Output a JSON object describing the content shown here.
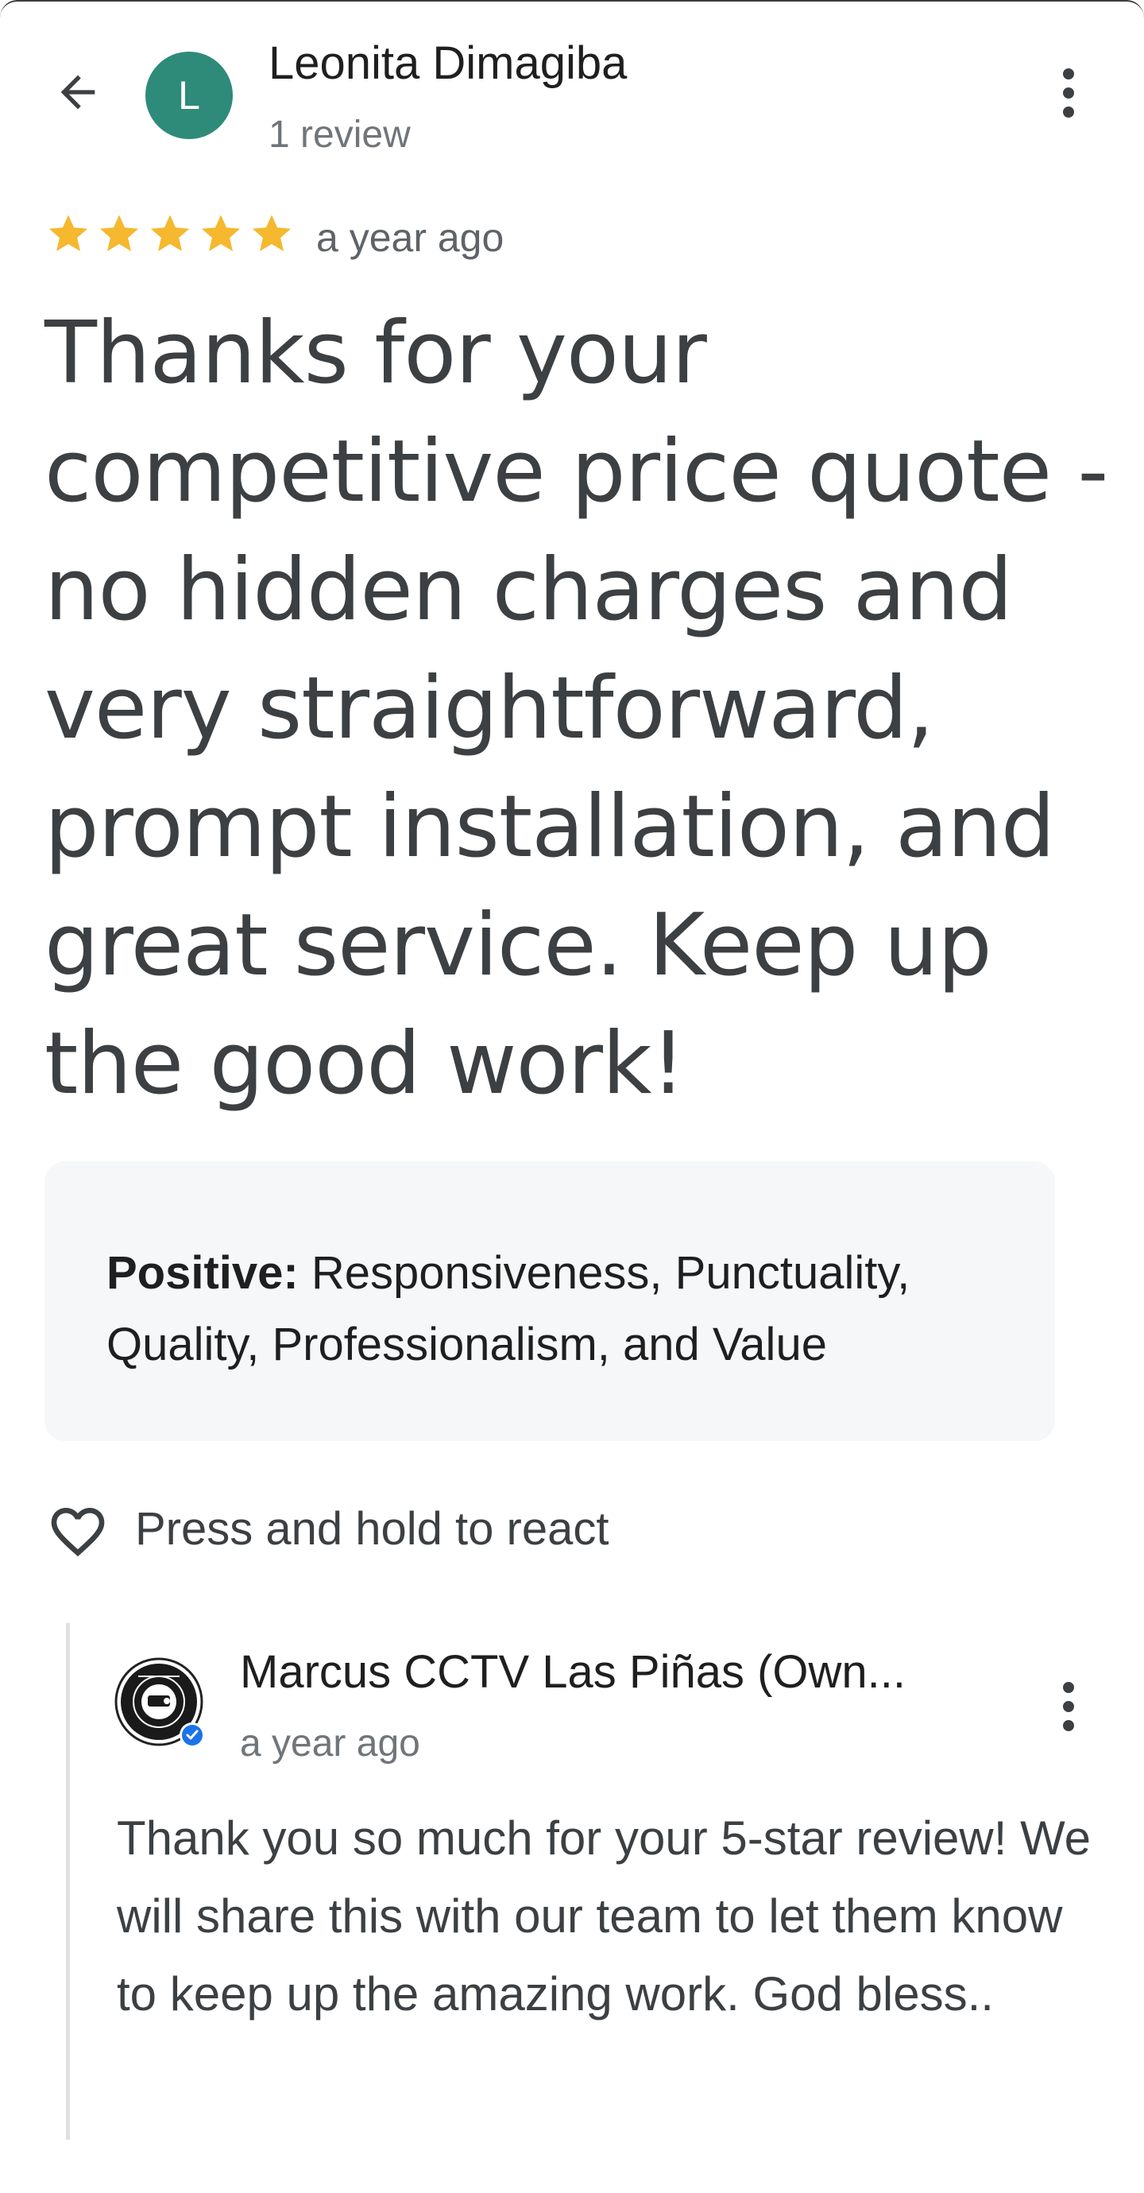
{
  "header": {
    "avatar_letter": "L",
    "avatar_color": "#2e8b79",
    "reviewer_name": "Leonita Dimagiba",
    "review_count": "1 review",
    "back_icon": "arrow-back-icon",
    "more_icon": "more-vert-icon"
  },
  "review": {
    "rating": 5,
    "rating_max": 5,
    "star_color": "#f5b82e",
    "time": "a year ago",
    "text": "Thanks for your competitive price quote - no hidden charges and very straightforward, prompt installation, and great service. Keep up the good work!"
  },
  "attributes": {
    "label": "Positive:",
    "value": " Responsiveness, Punctuality, Quality, Professionalism, and Value"
  },
  "react": {
    "icon": "heart-outline-icon",
    "label": "Press and hold to react"
  },
  "owner_response": {
    "name": "Marcus CCTV Las Piñas (Own...",
    "time": "a year ago",
    "verified_color": "#1a73e8",
    "text": "Thank you so much for your 5-star review! We will share this with our team to let them know to keep up the amazing work. God bless.."
  }
}
